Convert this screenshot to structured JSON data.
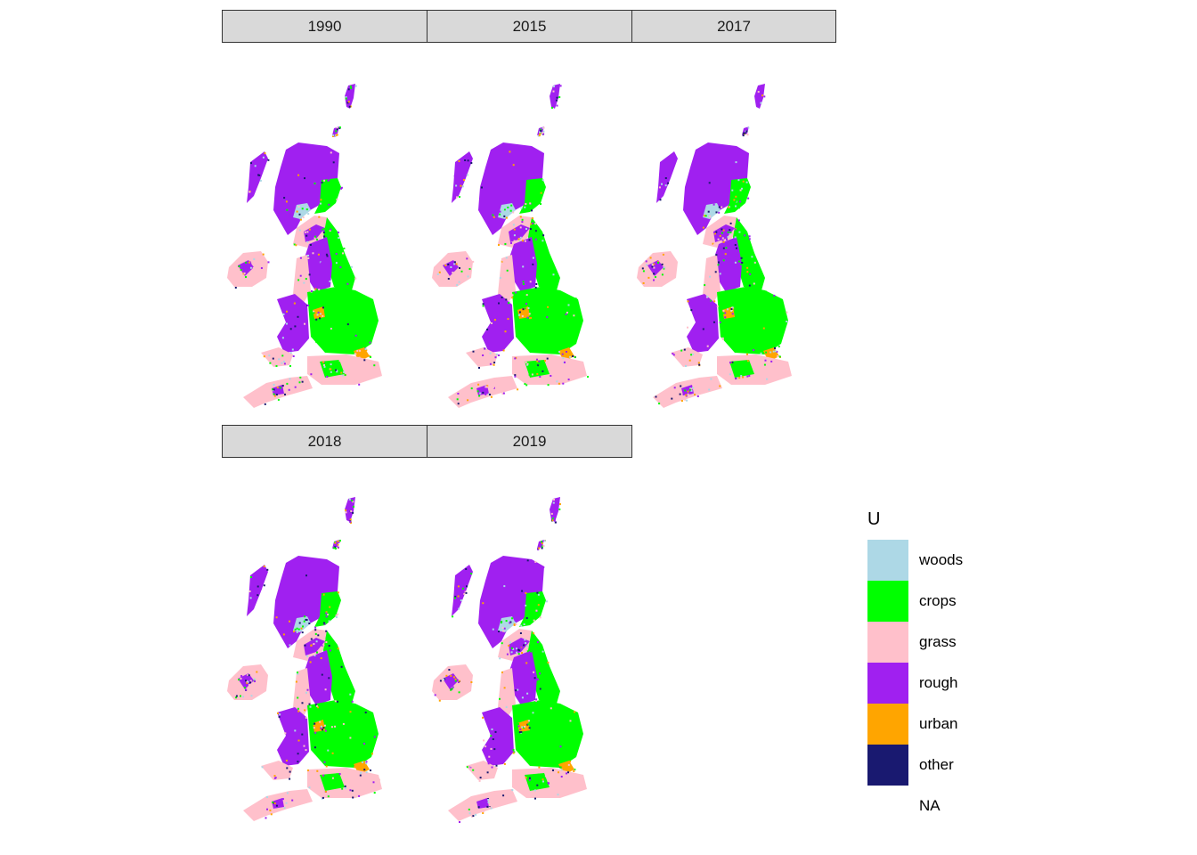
{
  "chart_data": {
    "type": "heatmap",
    "description": "Faceted raster maps of UK land use by category",
    "facet_variable": "year",
    "panels": [
      {
        "label": "1990"
      },
      {
        "label": "2015"
      },
      {
        "label": "2017"
      },
      {
        "label": "2018"
      },
      {
        "label": "2019"
      }
    ],
    "legend": {
      "title": "U",
      "placement": "right",
      "entries": [
        {
          "label": "woods",
          "color": "#add8e6"
        },
        {
          "label": "crops",
          "color": "#00ff00"
        },
        {
          "label": "grass",
          "color": "#ffc0cb"
        },
        {
          "label": "rough",
          "color": "#a020f0"
        },
        {
          "label": "urban",
          "color": "#ffa500"
        },
        {
          "label": "other",
          "color": "#191970"
        },
        {
          "label": "NA",
          "color": "#ffffff"
        }
      ]
    },
    "regions": {
      "scotland_highlands": "rough",
      "scotland_east_coast": "crops",
      "northern_ireland": "grass",
      "wales": "rough",
      "east_england": "crops",
      "southwest": "grass",
      "london": "urban"
    }
  }
}
